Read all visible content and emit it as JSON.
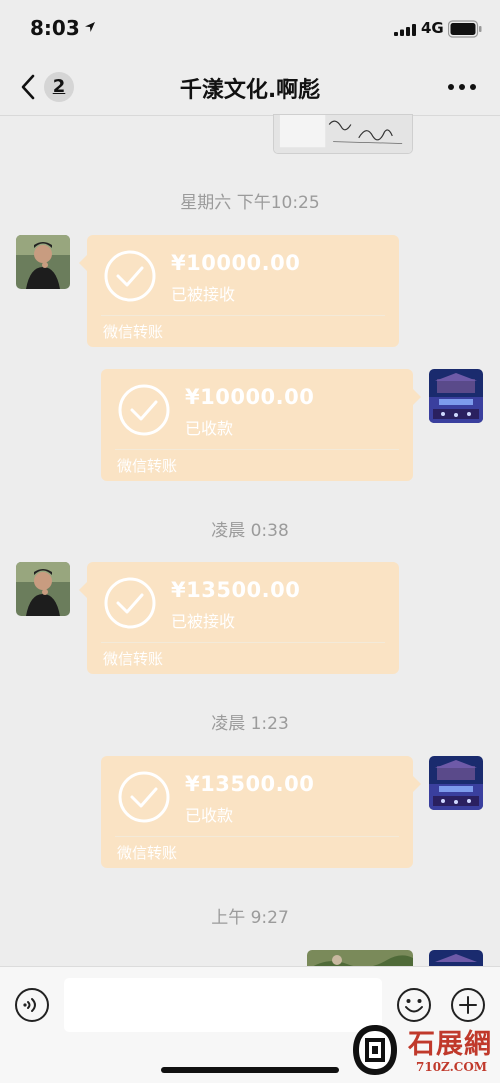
{
  "status_bar": {
    "time": "8:03",
    "network": "4G"
  },
  "nav": {
    "unread_count": "2",
    "title": "千漾文化.啊彪"
  },
  "time_labels": [
    "星期六 下午10:25",
    "凌晨 0:38",
    "凌晨 1:23",
    "上午 9:27"
  ],
  "messages": [
    {
      "sender": "contact",
      "amount": "¥10000.00",
      "status": "已被接收",
      "footer": "微信转账"
    },
    {
      "sender": "self",
      "amount": "¥10000.00",
      "status": "已收款",
      "footer": "微信转账"
    },
    {
      "sender": "contact",
      "amount": "¥13500.00",
      "status": "已被接收",
      "footer": "微信转账"
    },
    {
      "sender": "self",
      "amount": "¥13500.00",
      "status": "已收款",
      "footer": "微信转账"
    }
  ],
  "input": {
    "placeholder": ""
  },
  "watermark": {
    "logo_text": "石展網",
    "url": "710Z.COM"
  },
  "colors": {
    "background": "#ededed",
    "transfer_bubble": "#fae3c4",
    "watermark": "#c0392b"
  },
  "icons": [
    "back-icon",
    "more-icon",
    "check-icon",
    "voice-icon",
    "emoji-icon",
    "plus-icon",
    "location-icon",
    "signal-icon",
    "battery-icon"
  ]
}
